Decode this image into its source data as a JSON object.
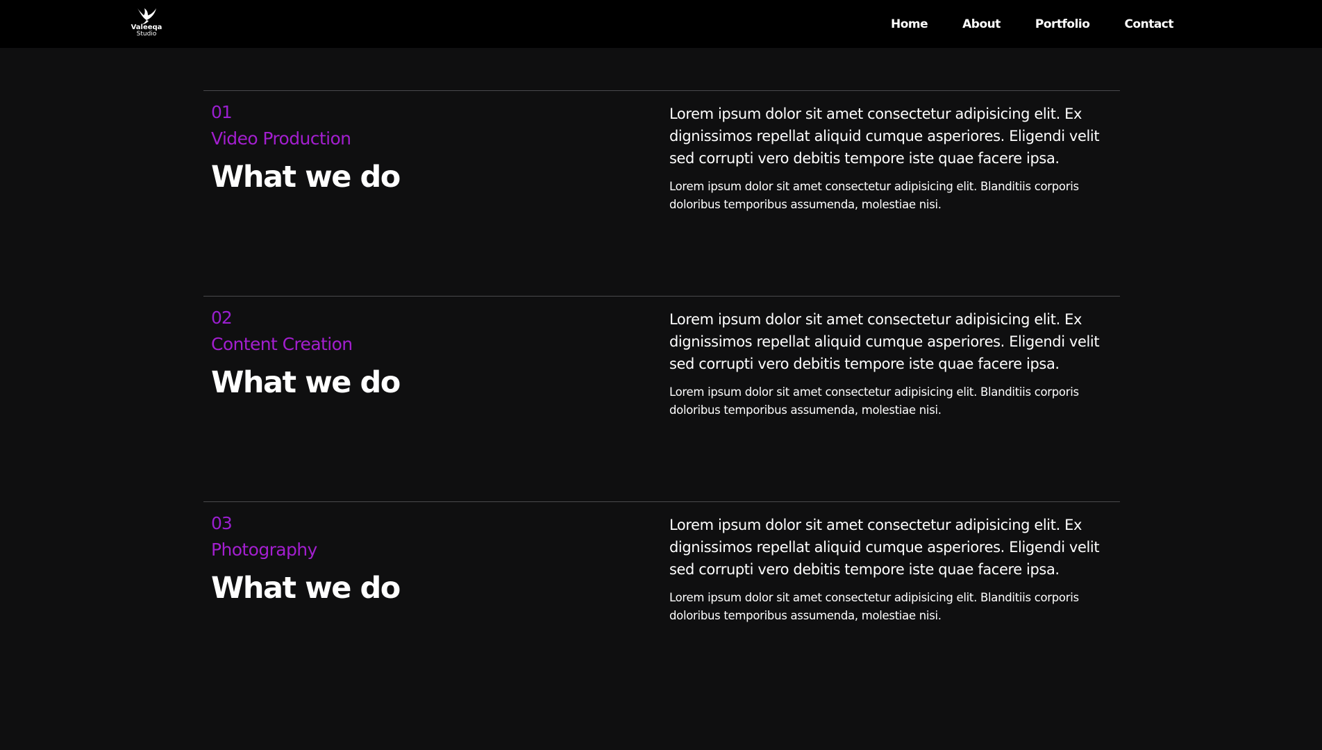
{
  "brand": {
    "name": "Valeeqa",
    "sub": "Studio"
  },
  "nav": {
    "items": [
      {
        "label": "Home"
      },
      {
        "label": "About"
      },
      {
        "label": "Portfolio"
      },
      {
        "label": "Contact"
      }
    ]
  },
  "services": [
    {
      "number": "01",
      "name": "Video Production",
      "heading": "What we do",
      "lead": "Lorem ipsum dolor sit amet consectetur adipisicing elit. Ex dignissimos repellat aliquid cumque asperiores. Eligendi velit sed corrupti vero debitis tempore iste quae facere ipsa.",
      "detail": "Lorem ipsum dolor sit amet consectetur adipisicing elit. Blanditiis corporis doloribus temporibus assumenda, molestiae nisi."
    },
    {
      "number": "02",
      "name": "Content Creation",
      "heading": "What we do",
      "lead": "Lorem ipsum dolor sit amet consectetur adipisicing elit. Ex dignissimos repellat aliquid cumque asperiores. Eligendi velit sed corrupti vero debitis tempore iste quae facere ipsa.",
      "detail": "Lorem ipsum dolor sit amet consectetur adipisicing elit. Blanditiis corporis doloribus temporibus assumenda, molestiae nisi."
    },
    {
      "number": "03",
      "name": "Photography",
      "heading": "What we do",
      "lead": "Lorem ipsum dolor sit amet consectetur adipisicing elit. Ex dignissimos repellat aliquid cumque asperiores. Eligendi velit sed corrupti vero debitis tempore iste quae facere ipsa.",
      "detail": "Lorem ipsum dolor sit amet consectetur adipisicing elit. Blanditiis corporis doloribus temporibus assumenda, molestiae nisi."
    }
  ],
  "colors": {
    "background": "#0f0f10",
    "navbar": "#000000",
    "accent": "#9a1fd0",
    "divider": "#4a4a4d",
    "text": "#ffffff"
  },
  "icons": {
    "logo": "bird-logo-icon"
  }
}
